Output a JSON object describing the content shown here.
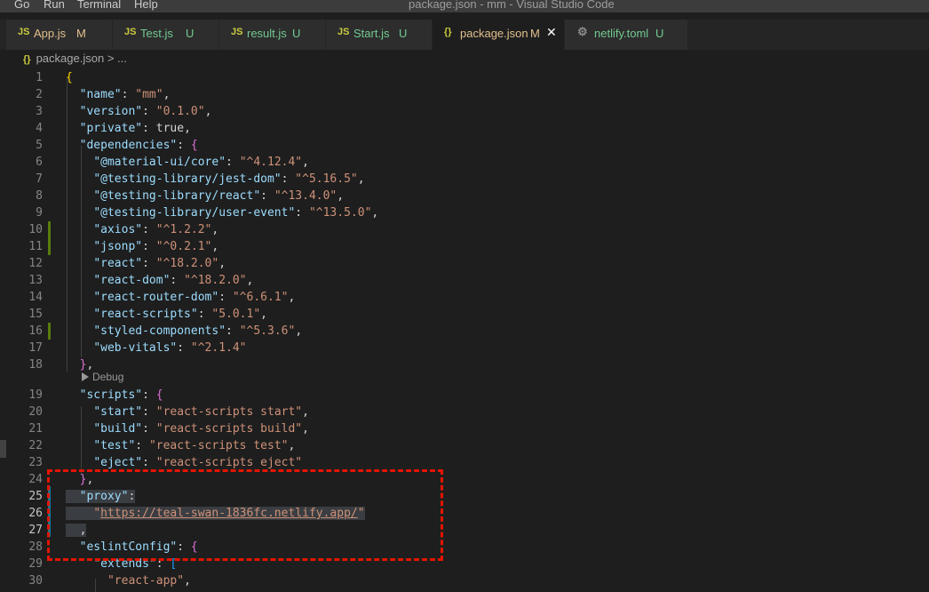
{
  "menu": [
    "Go",
    "Run",
    "Terminal",
    "Help"
  ],
  "window_title": "package.json - mm - Visual Studio Code",
  "tabs": [
    {
      "icon": "JS",
      "name": "App.js",
      "status": "M"
    },
    {
      "icon": "JS",
      "name": "Test.js",
      "status": "U"
    },
    {
      "icon": "JS",
      "name": "result.js",
      "status": "U"
    },
    {
      "icon": "JS",
      "name": "Start.js",
      "status": "U"
    },
    {
      "icon": "{}",
      "name": "package.json",
      "status": "M",
      "active": true
    },
    {
      "icon": "gear-icon",
      "name": "netlify.toml",
      "status": "U"
    }
  ],
  "breadcrumb": {
    "icon": "{}",
    "file": "package.json",
    "sep": "> ..."
  },
  "codelens": "Debug",
  "lines": [
    {
      "n": "1",
      "text": "{"
    },
    {
      "n": "2",
      "text": "  \"name\": \"mm\","
    },
    {
      "n": "3",
      "text": "  \"version\": \"0.1.0\","
    },
    {
      "n": "4",
      "text": "  \"private\": true,"
    },
    {
      "n": "5",
      "text": "  \"dependencies\": {"
    },
    {
      "n": "6",
      "text": "    \"@material-ui/core\": \"^4.12.4\","
    },
    {
      "n": "7",
      "text": "    \"@testing-library/jest-dom\": \"^5.16.5\","
    },
    {
      "n": "8",
      "text": "    \"@testing-library/react\": \"^13.4.0\","
    },
    {
      "n": "9",
      "text": "    \"@testing-library/user-event\": \"^13.5.0\","
    },
    {
      "n": "10",
      "text": "    \"axios\": \"^1.2.2\","
    },
    {
      "n": "11",
      "text": "    \"jsonp\": \"^0.2.1\","
    },
    {
      "n": "12",
      "text": "    \"react\": \"^18.2.0\","
    },
    {
      "n": "13",
      "text": "    \"react-dom\": \"^18.2.0\","
    },
    {
      "n": "14",
      "text": "    \"react-router-dom\": \"^6.6.1\","
    },
    {
      "n": "15",
      "text": "    \"react-scripts\": \"5.0.1\","
    },
    {
      "n": "16",
      "text": "    \"styled-components\": \"^5.3.6\","
    },
    {
      "n": "17",
      "text": "    \"web-vitals\": \"^2.1.4\""
    },
    {
      "n": "18",
      "text": "  },"
    },
    {
      "n": "19",
      "text": "  \"scripts\": {"
    },
    {
      "n": "20",
      "text": "    \"start\": \"react-scripts start\","
    },
    {
      "n": "21",
      "text": "    \"build\": \"react-scripts build\","
    },
    {
      "n": "22",
      "text": "    \"test\": \"react-scripts test\","
    },
    {
      "n": "23",
      "text": "    \"eject\": \"react-scripts eject\""
    },
    {
      "n": "24",
      "text": "  },"
    },
    {
      "n": "25",
      "text": "  \"proxy\":"
    },
    {
      "n": "26",
      "text": "    \"https://teal-swan-1836fc.netlify.app/\""
    },
    {
      "n": "27",
      "text": "  ,"
    },
    {
      "n": "28",
      "text": "  \"eslintConfig\": {"
    },
    {
      "n": "29",
      "text": "    \"extends\": ["
    },
    {
      "n": "30",
      "text": "      \"react-app\","
    }
  ],
  "colors": {
    "added": "#587c0c",
    "annotation": "#e51400",
    "string": "#ce9178",
    "key": "#9cdcfe"
  }
}
